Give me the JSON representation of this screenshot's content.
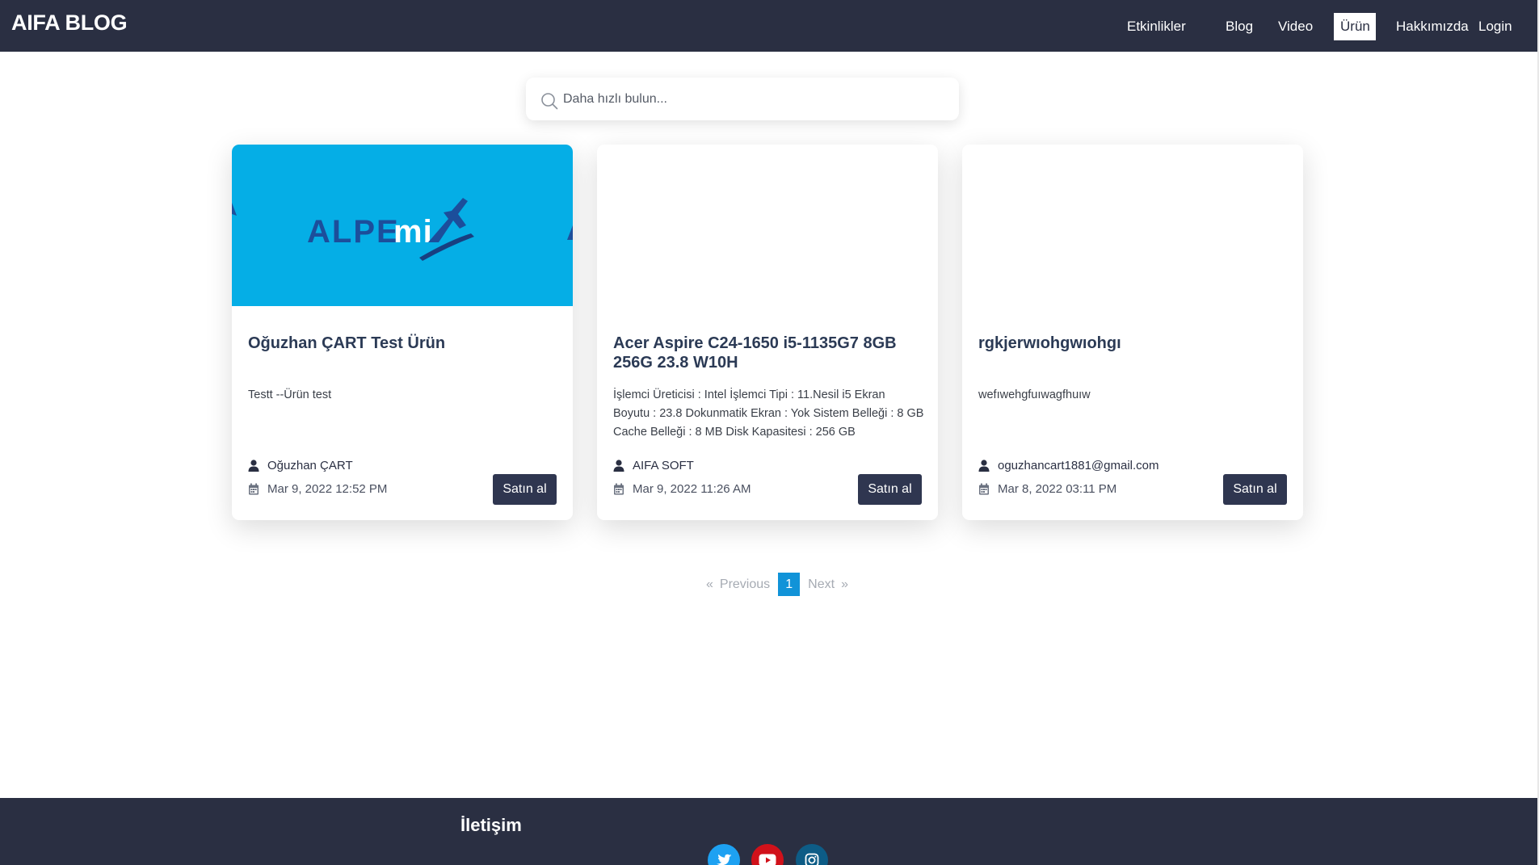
{
  "navbar": {
    "brand": "AIFA BLOG",
    "links": [
      "Etkinlikler",
      "Blog",
      "Video",
      "Ürün",
      "Hakkımızda",
      "Login"
    ],
    "active": "Ürün"
  },
  "search": {
    "placeholder": "Daha hızlı bulun..."
  },
  "cards": [
    {
      "image": "ALPEMIX logo banner",
      "title": "Oğuzhan ÇART Test Ürün",
      "description": "Testt --Ürün test",
      "author": "Oğuzhan ÇART",
      "date": "Mar 9, 2022 12:52 PM",
      "button": "Satın al"
    },
    {
      "title": "Acer Aspire C24-1650 i5-1135G7 8GB 256G 23.8 W10H",
      "description": "İşlemci Üreticisi : Intel İşlemci Tipi : 11.Nesil i5 Ekran Boyutu : 23.8 Dokunmatik Ekran : Yok Sistem Belleği : 8 GB Cache Belleği : 8 MB Disk Kapasitesi : 256 GB",
      "author": "AIFA SOFT",
      "date": "Mar 9, 2022 11:26 AM",
      "button": "Satın al"
    },
    {
      "title": "rgkjerwıohgwıohgı",
      "description": "wefıwehgfuıwagfhuıw",
      "author": "oguzhancart1881@gmail.com",
      "date": "Mar 8, 2022 03:11 PM",
      "button": "Satın al"
    }
  ],
  "pagination": {
    "prev_arrow": "«",
    "previous": "Previous",
    "current": "1",
    "next": "Next",
    "next_arrow": "»"
  },
  "footer": {
    "title": "İletişim",
    "social": [
      "twitter-icon",
      "youtube-icon",
      "instagram-icon"
    ]
  },
  "colors": {
    "navbar_bg": "#2a2f42",
    "banner_blue": "#05aee6",
    "button_bg": "#2f3650",
    "pagination_active": "#1193d8",
    "twitter": "#1da1f2",
    "youtube": "#d1111a",
    "instagram": "#0d5c86"
  }
}
